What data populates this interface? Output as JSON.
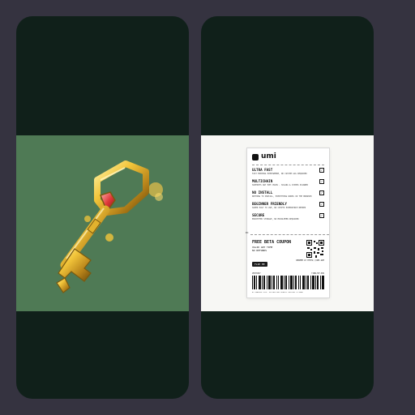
{
  "cards": [
    {
      "id": "key-card",
      "media": "golden-key-with-red-gem"
    },
    {
      "id": "receipt-card",
      "media": "umi-receipt"
    }
  ],
  "receipt": {
    "brand": "umi",
    "features": [
      {
        "title": "ULTRA FAST",
        "desc": "FAST MINTING EVERYWHERE, NO CUSTOM GAS REQUIRED"
      },
      {
        "title": "MULTICHAIN",
        "desc": "SUPPORTS ANY EVM CHAIN - SOLANA & COSMOS PLANNED"
      },
      {
        "title": "NO INSTALL",
        "desc": "NOTHING TO INSTALL, EVERYTHING WORKS IN THE BROWSER"
      },
      {
        "title": "BEGINNER FRIENDLY",
        "desc": "SUPER EASY TO USE, NO CRYPTO EXPERIENCE NEEDED"
      },
      {
        "title": "SECURE",
        "desc": "ENCRYPTED STORAGE, NO MIDDLEMEN REQUIRED"
      }
    ],
    "check_mark": "✓",
    "scissors": "✂",
    "coupon": {
      "title": "FREE BETA COUPON",
      "valid": "VALID ANY TIME",
      "refunds": "NO REFUNDS"
    },
    "redeem": "REDEEM AT HTTPS://UMI.APP",
    "flip": "FLIP ME",
    "meta_left": "UMIT0087",
    "meta_right": "T1BRL76F-889",
    "footer": "BY READING THIS, YOU ARE NOW LEGALLY OBLIGED TO READ"
  }
}
